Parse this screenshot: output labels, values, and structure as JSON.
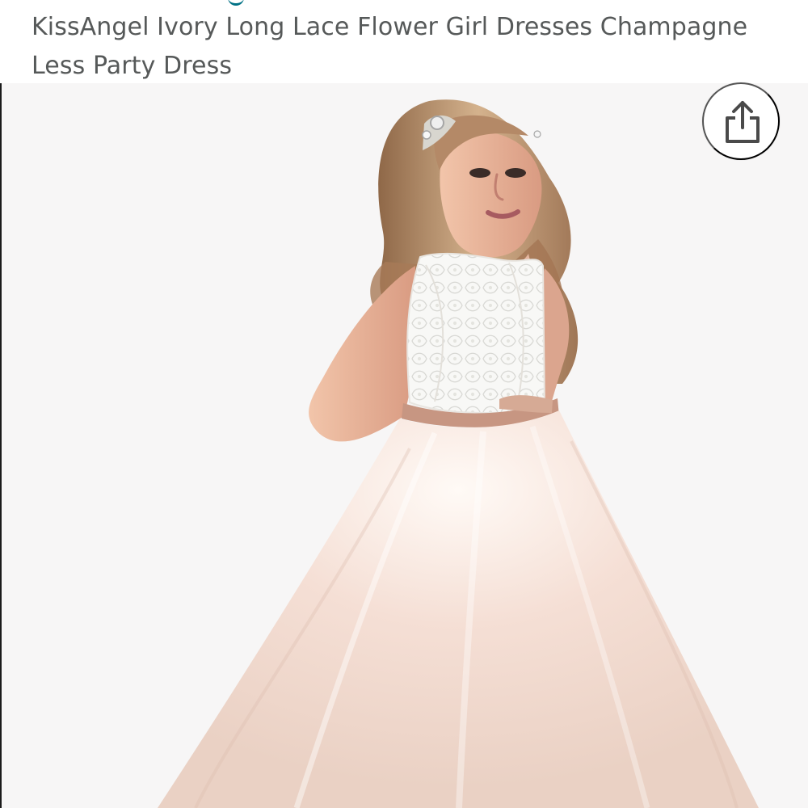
{
  "product": {
    "title": "KissAngel Ivory Long Lace Flower Girl Dresses Champagne Less Party Dress",
    "image_icon": "flower-girl-dress-photo"
  },
  "actions": {
    "share_icon": "share-icon"
  },
  "colors": {
    "title_text": "#565959",
    "image_background": "#f7f6f6",
    "share_icon": "#4a4a4a",
    "link_fragment": "#007185"
  }
}
